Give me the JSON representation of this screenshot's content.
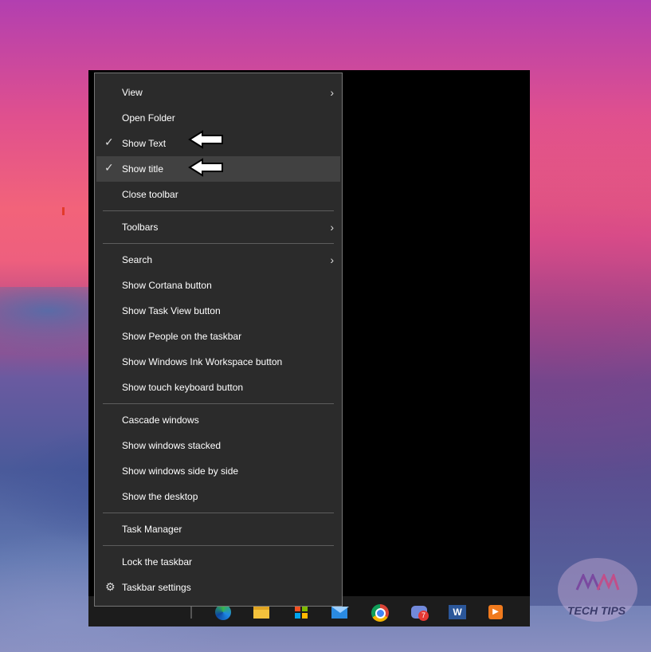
{
  "context_menu": {
    "items": [
      {
        "label": "View",
        "checked": false,
        "submenu": true
      },
      {
        "label": "Open Folder",
        "checked": false,
        "submenu": false
      },
      {
        "label": "Show Text",
        "checked": true,
        "submenu": false
      },
      {
        "label": "Show title",
        "checked": true,
        "submenu": false,
        "highlighted": true
      },
      {
        "label": "Close toolbar",
        "checked": false,
        "submenu": false
      },
      {
        "label": "Toolbars",
        "checked": false,
        "submenu": true
      },
      {
        "label": "Search",
        "checked": false,
        "submenu": true
      },
      {
        "label": "Show Cortana button",
        "checked": false,
        "submenu": false
      },
      {
        "label": "Show Task View button",
        "checked": false,
        "submenu": false
      },
      {
        "label": "Show People on the taskbar",
        "checked": false,
        "submenu": false
      },
      {
        "label": "Show Windows Ink Workspace button",
        "checked": false,
        "submenu": false
      },
      {
        "label": "Show touch keyboard button",
        "checked": false,
        "submenu": false
      },
      {
        "label": "Cascade windows",
        "checked": false,
        "submenu": false
      },
      {
        "label": "Show windows stacked",
        "checked": false,
        "submenu": false
      },
      {
        "label": "Show windows side by side",
        "checked": false,
        "submenu": false
      },
      {
        "label": "Show the desktop",
        "checked": false,
        "submenu": false
      },
      {
        "label": "Task Manager",
        "checked": false,
        "submenu": false
      },
      {
        "label": "Lock the taskbar",
        "checked": false,
        "submenu": false
      },
      {
        "label": "Taskbar settings",
        "checked": false,
        "submenu": false,
        "icon": "gear-icon"
      }
    ],
    "check_glyph": "✓",
    "chevron_glyph": "›",
    "gear_glyph": "⚙"
  },
  "taskbar": {
    "icons": [
      "edge-icon",
      "file-explorer-icon",
      "store-icon",
      "mail-icon",
      "chrome-icon",
      "discord-icon",
      "word-icon",
      "media-player-icon"
    ],
    "discord_badge": "7",
    "word_letter": "W"
  },
  "watermark": {
    "text": "TECH TIPS"
  },
  "colors": {
    "menu_bg": "#2b2b2b",
    "menu_highlight": "#414141",
    "menu_border": "#767676",
    "text": "#ffffff"
  }
}
